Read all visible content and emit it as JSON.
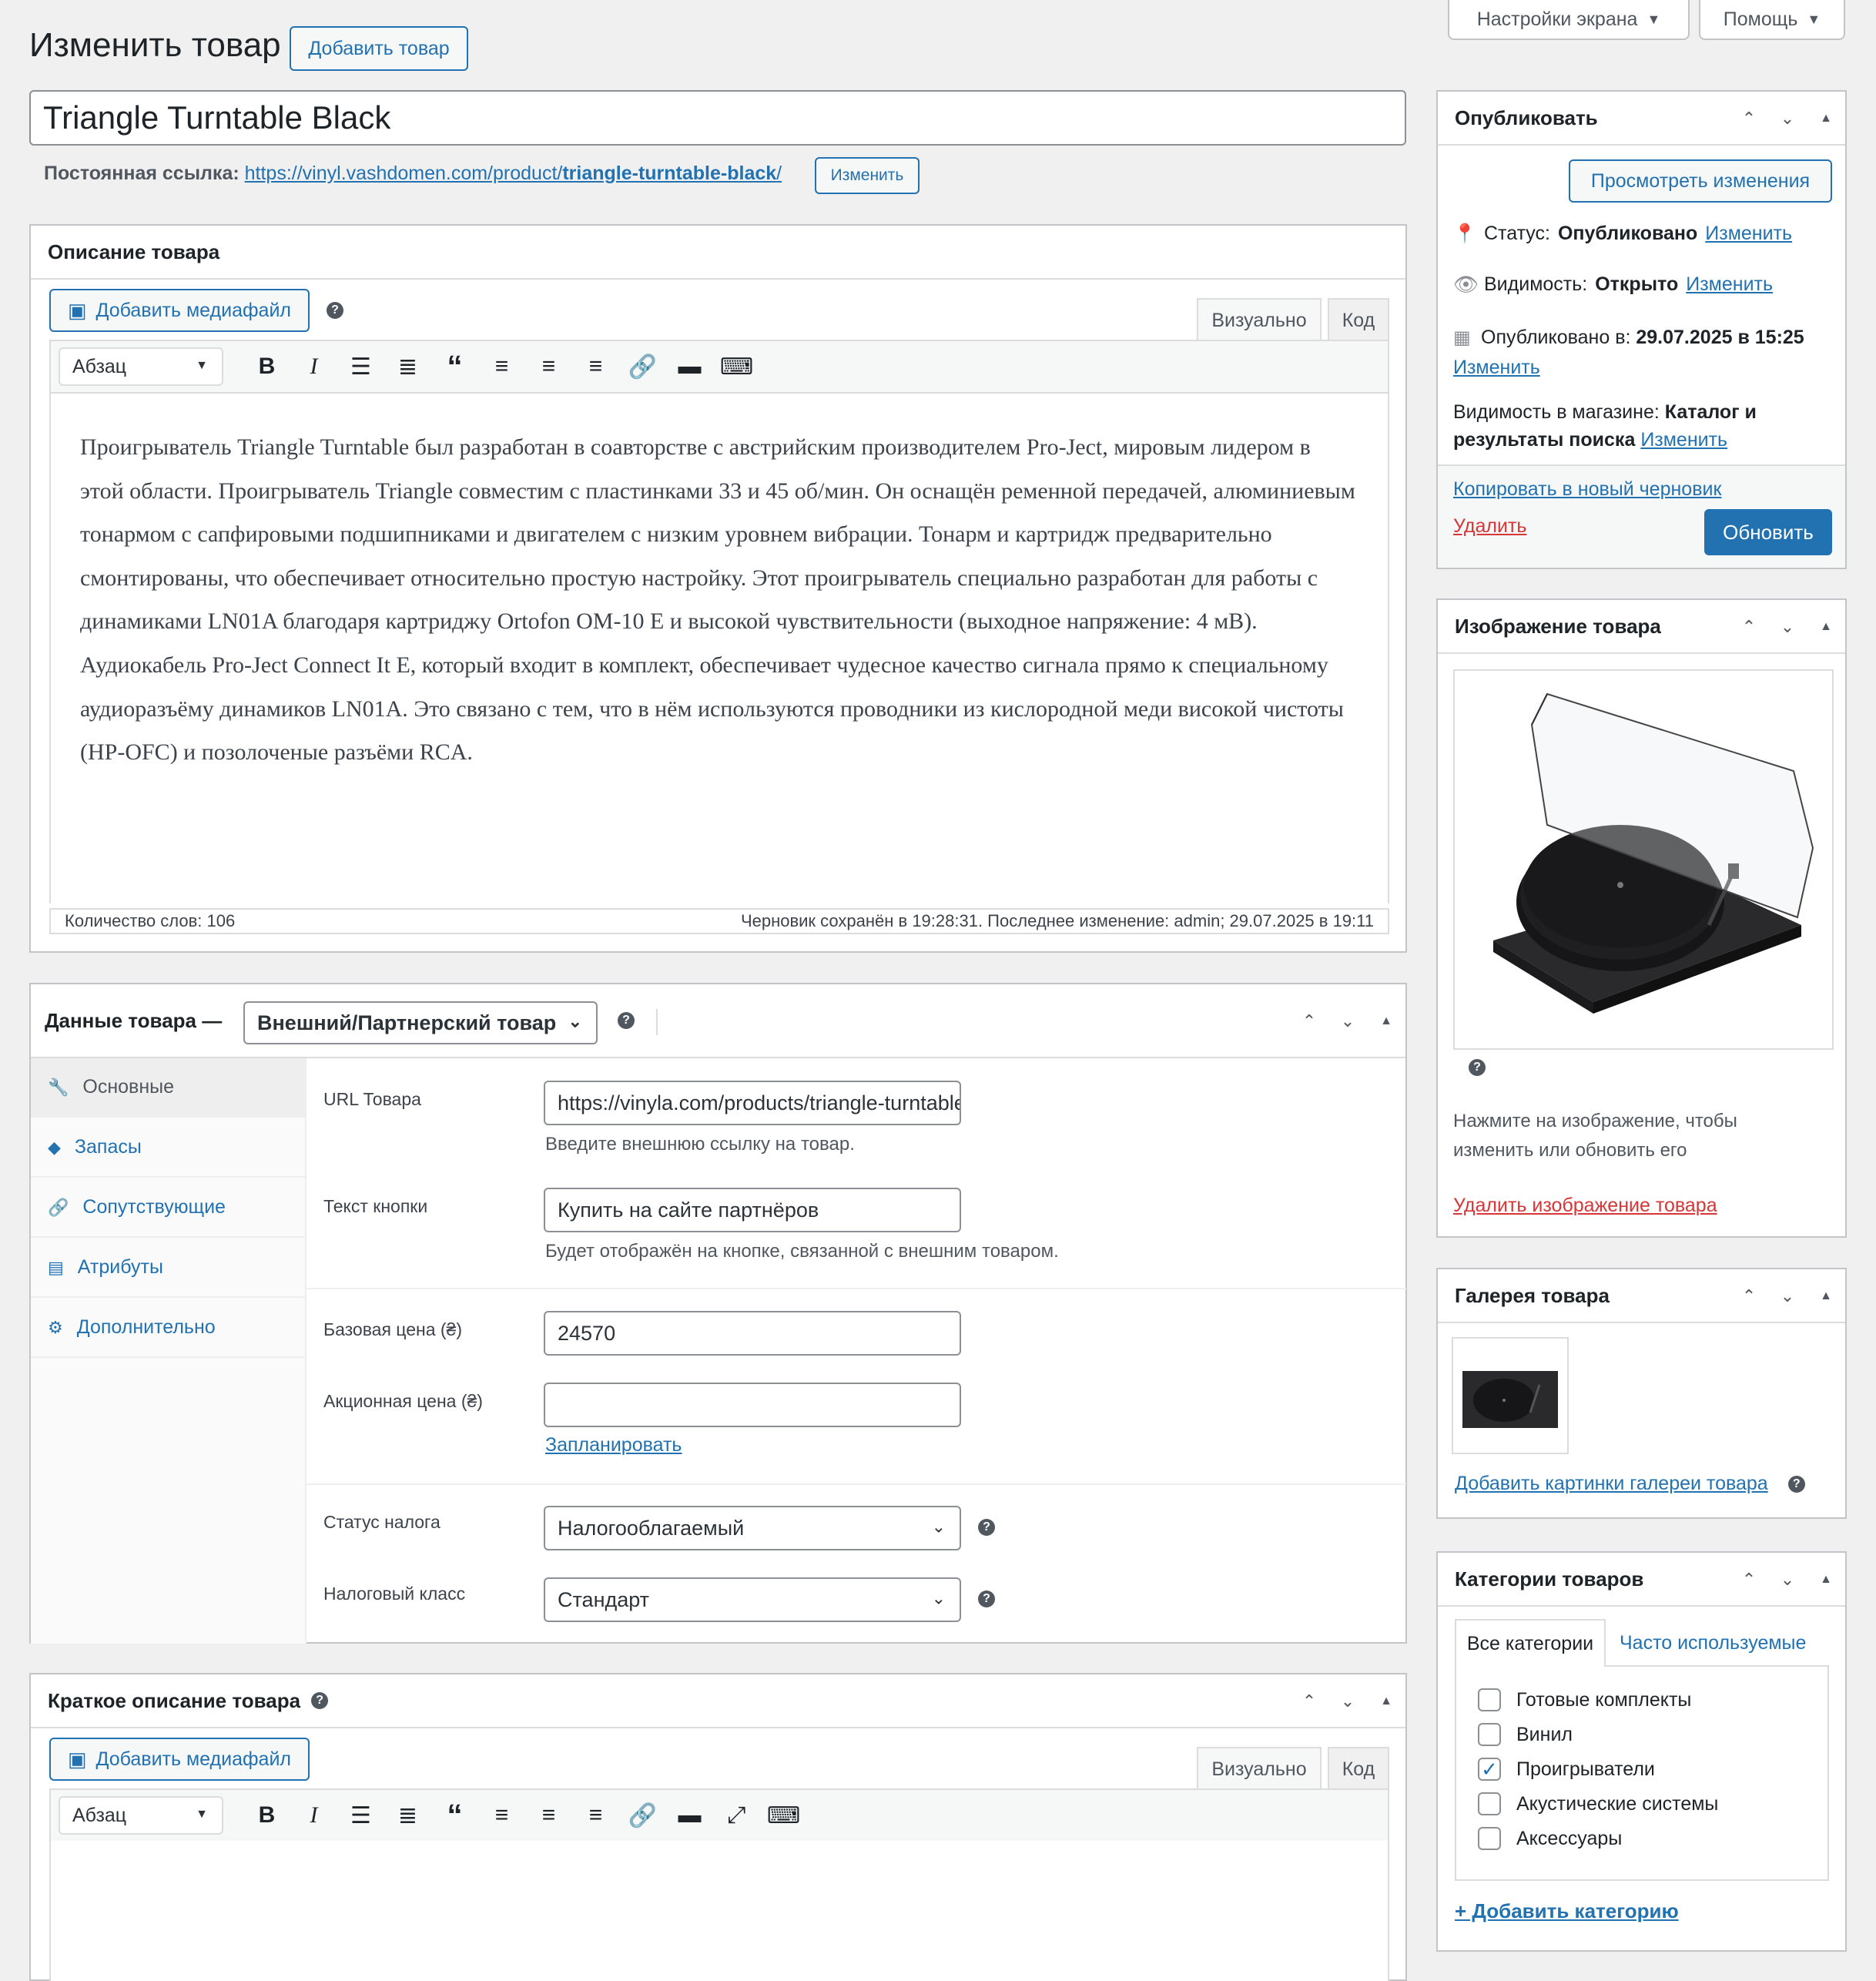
{
  "top_tabs": {
    "screen_options": "Настройки экрана",
    "help": "Помощь"
  },
  "page": {
    "title": "Изменить товар",
    "add_button": "Добавить товар"
  },
  "product": {
    "title": "Triangle Turntable Black",
    "permalink_label": "Постоянная ссылка:",
    "permalink_base": "https://vinyl.vashdomen.com/product/",
    "permalink_slug": "triangle-turntable-black",
    "permalink_end": "/",
    "permalink_edit": "Изменить"
  },
  "description": {
    "title": "Описание товара",
    "add_media": "Добавить медиафайл",
    "tab_visual": "Визуально",
    "tab_code": "Код",
    "format": "Абзац",
    "content": "Проигрыватель Triangle Turntable был разработан в соавторстве с австрийским производителем Pro-Ject, мировым лидером в этой области. Проигрыватель Triangle совместим с пластинками 33 и 45 об/мин. Он оснащён ременной передачей, алюминиевым тонармом с сапфировыми подшипниками и двигателем с низким уровнем вибрации. Тонарм и картридж предварительно смонтированы, что обеспечивает относительно простую настройку. Этот проигрыватель специально разработан для работы с динамиками LN01A благодаря картриджу Ortofon OM-10 E и высокой чувствительности (выходное напряжение: 4 мВ). Аудиокабель Pro-Ject Connect It E, который входит в комплект, обеспечивает чудесное качество сигнала прямо к специальному аудиоразъёму динамиков LN01A. Это связано с тем, что в нём используются проводники из кислородной меди високой чистоты (HP-OFC) и позолоченые разъёми RCA.",
    "word_count": "Количество слов: 106",
    "draft_saved": "Черновик сохранён в 19:28:31. Последнее изменение: admin; 29.07.2025 в 19:11"
  },
  "product_data": {
    "title": "Данные товара —",
    "type": "Внешний/Партнерский товар",
    "tabs": [
      {
        "label": "Основные",
        "icon": "wrench-icon"
      },
      {
        "label": "Запасы",
        "icon": "tag-icon"
      },
      {
        "label": "Сопутствующие",
        "icon": "link-icon"
      },
      {
        "label": "Атрибуты",
        "icon": "table-icon"
      },
      {
        "label": "Дополнительно",
        "icon": "gear-icon"
      }
    ],
    "url_label": "URL Товара",
    "url_value": "https://vinyla.com/products/triangle-turntable-black",
    "url_hint": "Введите внешнюю ссылку на товар.",
    "button_text_label": "Текст кнопки",
    "button_text_value": "Купить на сайте партнёров",
    "button_text_hint": "Будет отображён на кнопке, связанной с внешним товаром.",
    "regular_price_label": "Базовая цена (₴)",
    "regular_price_value": "24570",
    "sale_price_label": "Акционная цена (₴)",
    "sale_price_value": "",
    "schedule": "Запланировать",
    "tax_status_label": "Статус налога",
    "tax_status_value": "Налогооблагаемый",
    "tax_class_label": "Налоговый класс",
    "tax_class_value": "Стандарт"
  },
  "short_description": {
    "title": "Краткое описание товара",
    "add_media": "Добавить медиафайл",
    "tab_visual": "Визуально",
    "tab_code": "Код",
    "format": "Абзац"
  },
  "publish": {
    "title": "Опубликовать",
    "preview": "Просмотреть изменения",
    "status_label": "Статус:",
    "status_value": "Опубликовано",
    "visibility_label": "Видимость:",
    "visibility_value": "Открыто",
    "published_label": "Опубликовано в:",
    "published_value": "29.07.2025 в 15:25",
    "edit": "Изменить",
    "catalog_label": "Видимость в магазине:",
    "catalog_value": "Каталог и результаты поиска",
    "copy_draft": "Копировать в новый черновик",
    "delete": "Удалить",
    "update": "Обновить"
  },
  "product_image": {
    "title": "Изображение товара",
    "hint": "Нажмите на изображение, чтобы изменить или обновить его",
    "remove": "Удалить изображение товара"
  },
  "gallery": {
    "title": "Галерея товара",
    "add": "Добавить картинки галереи товара"
  },
  "categories": {
    "title": "Категории товаров",
    "tab_all": "Все категории",
    "tab_popular": "Часто используемые",
    "items": [
      {
        "label": "Готовые комплекты",
        "checked": false
      },
      {
        "label": "Винил",
        "checked": false
      },
      {
        "label": "Проигрыватели",
        "checked": true
      },
      {
        "label": "Акустические системы",
        "checked": false
      },
      {
        "label": "Аксессуары",
        "checked": false
      }
    ],
    "add": "+ Добавить категорию"
  }
}
